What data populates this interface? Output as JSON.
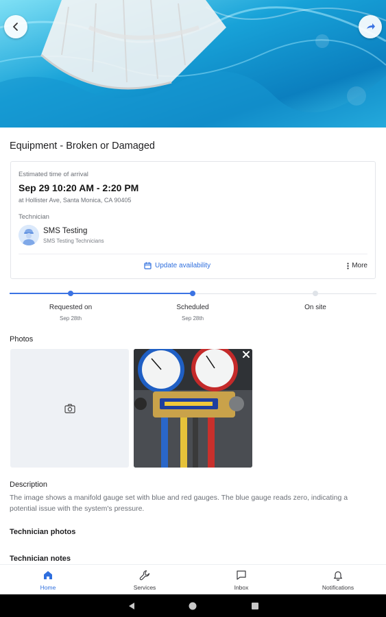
{
  "header": {
    "back_icon": "arrow-left-icon",
    "share_icon": "share-icon"
  },
  "request": {
    "title": "Equipment - Broken or Damaged"
  },
  "eta_card": {
    "label": "Estimated time of arrival",
    "time": "Sep 29 10:20 AM - 2:20 PM",
    "address": "at Hollister Ave,  Santa Monica, CA 90405",
    "technician_label": "Technician",
    "technician_name": "SMS Testing",
    "technician_company": "SMS Testing Technicians",
    "update_label": "Update availability",
    "more_label": "More"
  },
  "progress": {
    "steps": [
      {
        "label": "Requested on",
        "date": "Sep 28th",
        "state": "done"
      },
      {
        "label": "Scheduled",
        "date": "Sep 28th",
        "state": "done"
      },
      {
        "label": "On site",
        "date": "",
        "state": "pending"
      }
    ]
  },
  "photos": {
    "label": "Photos",
    "add_icon": "camera-icon",
    "count": 1
  },
  "description": {
    "label": "Description",
    "text": "The image shows a manifold gauge set with blue and red gauges. The blue gauge reads zero, indicating a potential issue with the system's pressure."
  },
  "technician_photos_label": "Technician photos",
  "technician_notes_label": "Technician notes",
  "bottom_nav": {
    "items": [
      {
        "label": "Home",
        "icon": "home-icon",
        "active": true
      },
      {
        "label": "Services",
        "icon": "wrench-icon",
        "active": false
      },
      {
        "label": "Inbox",
        "icon": "message-icon",
        "active": false
      },
      {
        "label": "Notifications",
        "icon": "bell-icon",
        "active": false
      }
    ]
  },
  "colors": {
    "accent": "#2f6fde",
    "progress_done": "#3b73e3",
    "progress_pending": "#dfe3e8"
  }
}
